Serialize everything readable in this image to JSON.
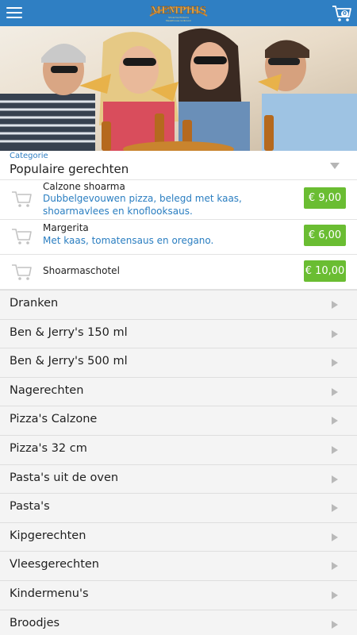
{
  "header": {
    "logo_text": "MEMPHIS",
    "logo_subtitle": "Shoarma Pizzeria Steakhouse Grillroom",
    "cart_count": "0",
    "icons": [
      "menu-icon",
      "shopping-cart-icon"
    ],
    "color": "#2f7fc3"
  },
  "category": {
    "label": "Categorie",
    "title": "Populaire gerechten"
  },
  "products": [
    {
      "name": "Calzone shoarma",
      "desc": "Dubbelgevouwen pizza, belegd met kaas, shoarmavlees en knoflooksaus.",
      "price": "€ 9,00"
    },
    {
      "name": "Margerita",
      "desc": "Met kaas, tomatensaus en oregano.",
      "price": "€ 6,00"
    },
    {
      "name": "Shoarmaschotel",
      "desc": "",
      "price": "€ 10,00"
    }
  ],
  "categories": [
    "Dranken",
    "Ben & Jerry's 150 ml",
    "Ben & Jerry's 500 ml",
    "Nagerechten",
    "Pizza's Calzone",
    "Pizza's 32 cm",
    "Pasta's uit de oven",
    "Pasta's",
    "Kipgerechten",
    "Vleesgerechten",
    "Kindermenu's",
    "Broodjes"
  ],
  "colors": {
    "accent": "#2f7fc3",
    "price_bg": "#6abd32",
    "list_bg": "#f4f4f4"
  }
}
